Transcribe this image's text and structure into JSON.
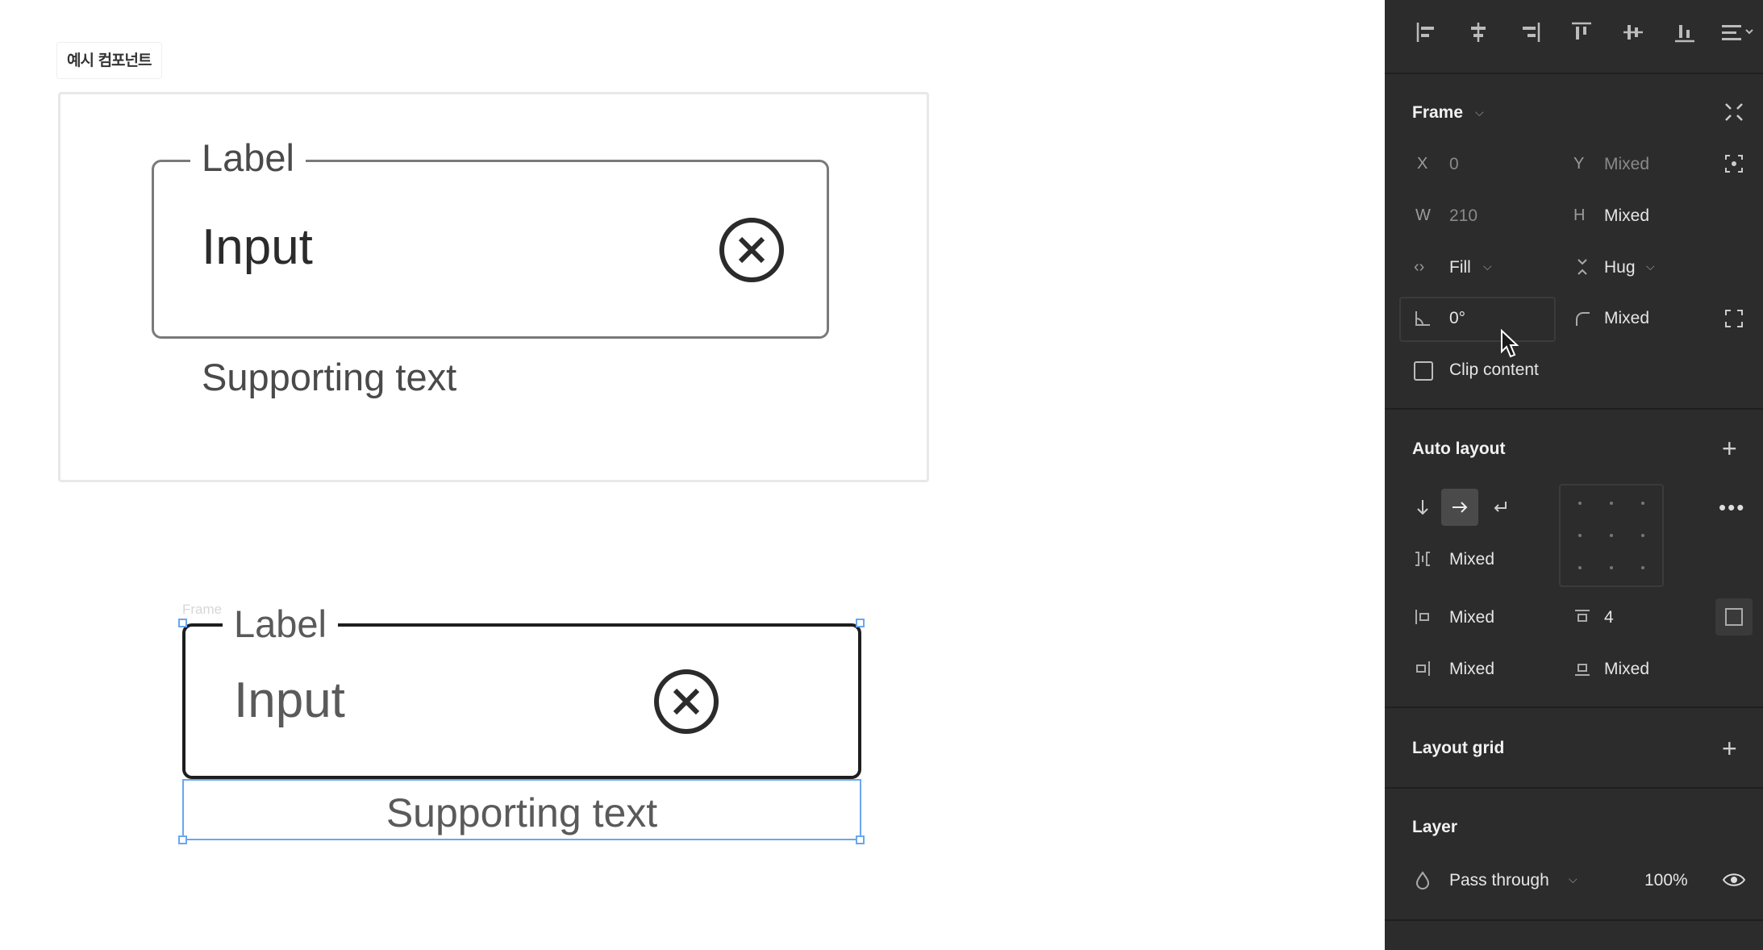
{
  "canvas": {
    "example_tag": "예시 컴포넌트",
    "frame_ghost_label": "Frame 5",
    "component1": {
      "label": "Label",
      "input": "Input",
      "supporting": "Supporting text"
    },
    "component2": {
      "label": "Label",
      "input": "Input",
      "supporting": "Supporting text"
    }
  },
  "panel": {
    "frame": {
      "title": "Frame",
      "x_label": "X",
      "x_value": "0",
      "y_label": "Y",
      "y_value": "Mixed",
      "w_label": "W",
      "w_value": "210",
      "h_label": "H",
      "h_value": "Mixed",
      "horizontal_resizing": "Fill",
      "vertical_resizing": "Hug",
      "rotation": "0°",
      "corner_radius": "Mixed",
      "clip_content": "Clip content"
    },
    "auto_layout": {
      "title": "Auto layout",
      "spacing": "Mixed",
      "padding_left": "Mixed",
      "padding_top": "4",
      "padding_right": "Mixed",
      "padding_bottom": "Mixed"
    },
    "layout_grid": {
      "title": "Layout grid"
    },
    "layer": {
      "title": "Layer",
      "blend_mode": "Pass through",
      "opacity": "100%"
    }
  },
  "colors": {
    "panel_bg": "#2c2c2c",
    "selection": "#6aa7ef",
    "field_border": "#7a7a7a"
  }
}
